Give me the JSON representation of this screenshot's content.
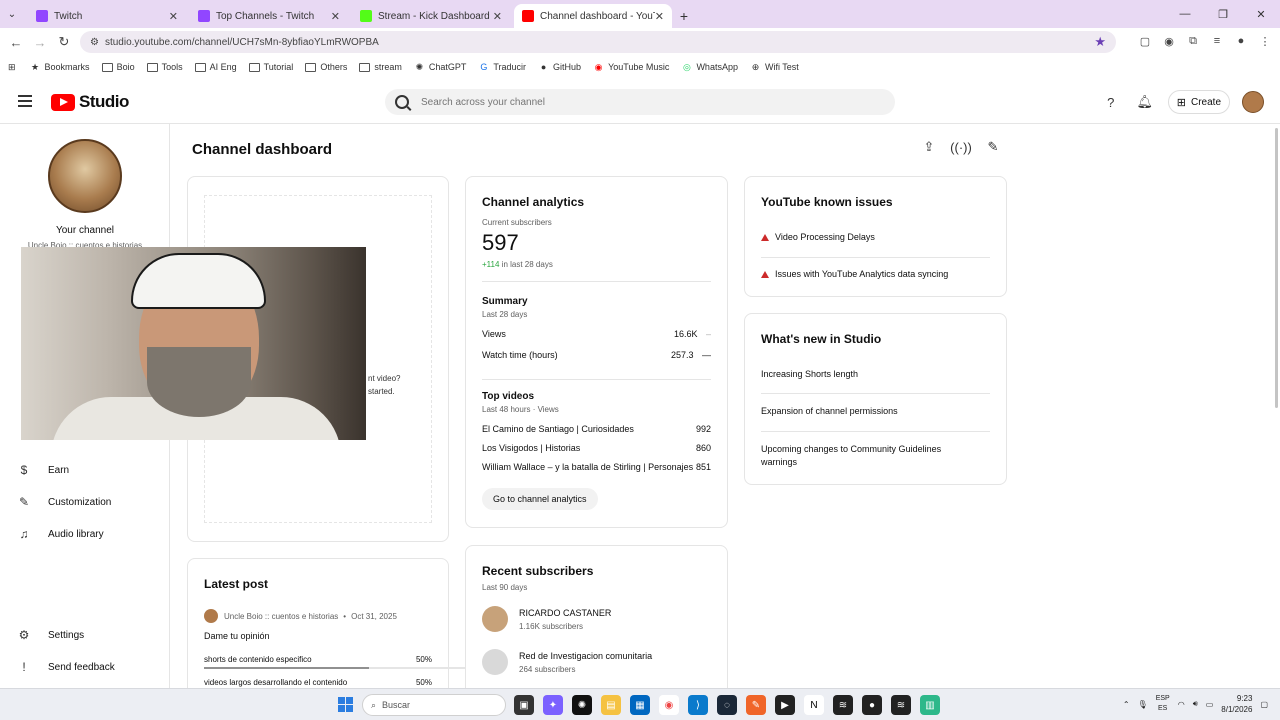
{
  "browser": {
    "tabs": [
      {
        "title": "Twitch",
        "color": "#9146ff",
        "active": false
      },
      {
        "title": "Top Channels - Twitch",
        "color": "#9146ff",
        "active": false
      },
      {
        "title": "Stream - Kick Dashboard",
        "color": "#53fc18",
        "active": false
      },
      {
        "title": "Channel dashboard - YouTube",
        "color": "#ff0000",
        "active": true
      }
    ],
    "url": "studio.youtube.com/channel/UCH7sMn-8ybfiaoYLmRWOPBA",
    "bookmarks": [
      "Bookmarks",
      "Boio",
      "Tools",
      "AI Eng",
      "Tutorial",
      "Others",
      "stream",
      "ChatGPT",
      "Traducir",
      "GitHub",
      "YouTube Music",
      "WhatsApp",
      "Wifi Test"
    ]
  },
  "header": {
    "logo_text": "Studio",
    "search_placeholder": "Search across your channel",
    "create_label": "Create"
  },
  "sidebar": {
    "channel_label": "Your channel",
    "channel_name": "Uncle Boio :: cuentos e historias",
    "items": [
      {
        "label": "Earn",
        "icon": "dollar-icon"
      },
      {
        "label": "Customization",
        "icon": "wand-icon"
      },
      {
        "label": "Audio library",
        "icon": "audio-library-icon"
      },
      {
        "label": "Settings",
        "icon": "gear-icon"
      },
      {
        "label": "Send feedback",
        "icon": "feedback-icon"
      }
    ]
  },
  "main": {
    "title": "Channel dashboard",
    "upload_card": {
      "text_line1": "nt video?",
      "text_line2": "started."
    },
    "analytics": {
      "title": "Channel analytics",
      "subs_label": "Current subscribers",
      "subs_value": "597",
      "subs_change": "+114",
      "subs_change_suffix": "in last 28 days",
      "summary_title": "Summary",
      "summary_period": "Last 28 days",
      "summary_rows": [
        {
          "label": "Views",
          "value": "16.6K",
          "trend": "–"
        },
        {
          "label": "Watch time (hours)",
          "value": "257.3",
          "trend": "—"
        }
      ],
      "top_title": "Top videos",
      "top_period": "Last 48 hours · Views",
      "top_videos": [
        {
          "title": "El Camino de Santiago | Curiosidades",
          "views": "992"
        },
        {
          "title": "Los Visigodos | Historias",
          "views": "860"
        },
        {
          "title": "William Wallace – y la batalla de Stirling | Personajes",
          "views": "851"
        }
      ],
      "button": "Go to channel analytics"
    },
    "issues": {
      "title": "YouTube known issues",
      "items": [
        "Video Processing Delays",
        "Issues with YouTube Analytics data syncing"
      ]
    },
    "whats_new": {
      "title": "What's new in Studio",
      "items": [
        "Increasing Shorts length",
        "Expansion of channel permissions",
        "Upcoming changes to Community Guidelines warnings"
      ]
    },
    "latest_post": {
      "title": "Latest post",
      "author": "Uncle Boio :: cuentos e historias",
      "date": "Oct 31, 2025",
      "question": "Dame tu opinión",
      "options": [
        {
          "label": "shorts de contenido especifico",
          "pct": "50%",
          "fraction": 0.5
        },
        {
          "label": "videos largos desarrollando el contenido",
          "pct": "50%",
          "fraction": 0.5
        }
      ]
    },
    "recent_subscribers": {
      "title": "Recent subscribers",
      "period": "Last 90 days",
      "items": [
        {
          "name": "RICARDO CASTANER",
          "subs": "1.16K subscribers"
        },
        {
          "name": "Red de Investigacion comunitaria",
          "subs": "264 subscribers"
        }
      ]
    }
  },
  "taskbar": {
    "search_placeholder": "Buscar",
    "lang1": "ESP",
    "lang2": "ES",
    "time": "9:23",
    "date": "8/1/2026"
  }
}
